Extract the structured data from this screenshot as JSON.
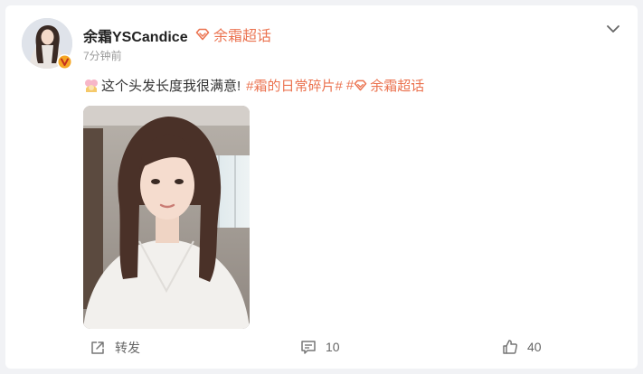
{
  "post": {
    "user_name": "余霜YSCandice",
    "super_topic": "余霜超话",
    "time": "7分钟前",
    "text": "这个头发长度我很满意!",
    "hashtag1": "#霜的日常碎片#",
    "hashtag2": "余霜超话"
  },
  "actions": {
    "repost_label": "转发",
    "comment_count": "10",
    "like_count": "40"
  },
  "icons": {
    "verified_badge": "verified-badge-icon",
    "super_topic": "diamond-icon",
    "menu": "chevron-down-icon",
    "emoji": "emoji-icon",
    "repost": "repost-icon",
    "comment": "comment-icon",
    "like": "thumbs-up-icon"
  },
  "colors": {
    "accent": "#eb7350",
    "background": "#f1f2f5",
    "card": "#ffffff"
  }
}
